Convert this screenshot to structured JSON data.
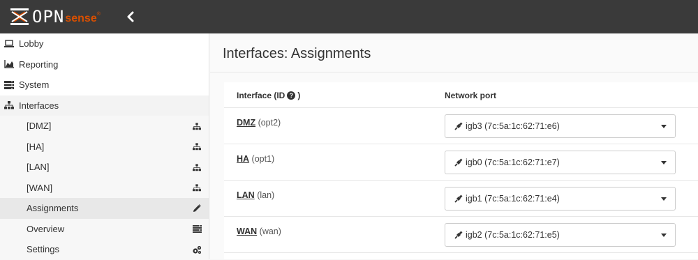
{
  "brand": {
    "word": "OPN",
    "sense": "sense",
    "reg": "®"
  },
  "sidebar": {
    "items": [
      {
        "label": "Lobby",
        "icon": "laptop-icon"
      },
      {
        "label": "Reporting",
        "icon": "area-chart-icon"
      },
      {
        "label": "System",
        "icon": "server-icon"
      },
      {
        "label": "Interfaces",
        "icon": "sitemap-icon"
      }
    ],
    "sub_items": [
      {
        "label": "[DMZ]",
        "icon": "sitemap-icon"
      },
      {
        "label": "[HA]",
        "icon": "sitemap-icon"
      },
      {
        "label": "[LAN]",
        "icon": "sitemap-icon"
      },
      {
        "label": "[WAN]",
        "icon": "sitemap-icon"
      },
      {
        "label": "Assignments",
        "icon": "pencil-icon",
        "active": true
      },
      {
        "label": "Overview",
        "icon": "list-icon"
      },
      {
        "label": "Settings",
        "icon": "cogs-icon"
      }
    ]
  },
  "main": {
    "title": "Interfaces: Assignments",
    "table": {
      "col_interface": "Interface (ID",
      "col_interface_suffix": ")",
      "col_port": "Network port",
      "rows": [
        {
          "name": "DMZ",
          "id": "(opt2)",
          "port": "igb3 (7c:5a:1c:62:71:e6)"
        },
        {
          "name": "HA",
          "id": "(opt1)",
          "port": "igb0 (7c:5a:1c:62:71:e7)"
        },
        {
          "name": "LAN",
          "id": "(lan)",
          "port": "igb1 (7c:5a:1c:62:71:e4)"
        },
        {
          "name": "WAN",
          "id": "(wan)",
          "port": "igb2 (7c:5a:1c:62:71:e5)"
        }
      ]
    }
  },
  "colors": {
    "topbar": "#3a3a3a",
    "accent": "#d94f00"
  }
}
